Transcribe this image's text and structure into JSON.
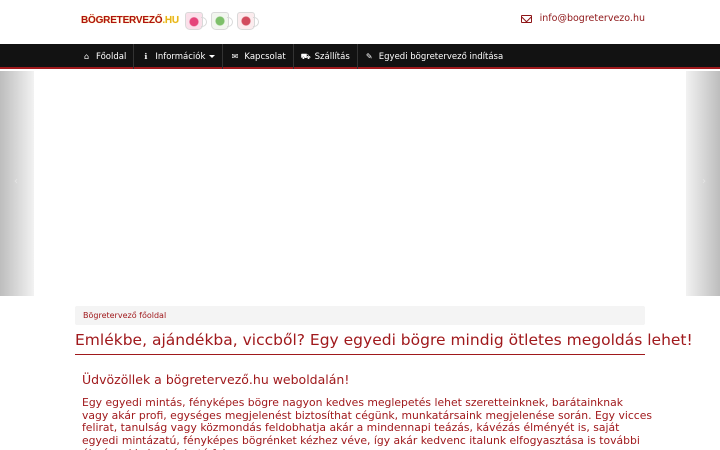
{
  "header": {
    "logo_main": "BÖGRETERVEZŐ",
    "logo_suffix": ".HU",
    "logo_icon_names": [
      "heart-mug-icon",
      "photo-mug-icon",
      "floral-mug-icon"
    ],
    "email": "info@bogretervezo.hu",
    "email_icon": "envelope-icon"
  },
  "nav": {
    "items": [
      {
        "label": "Főoldal",
        "icon": "home-icon"
      },
      {
        "label": "Információk",
        "icon": "info-icon"
      },
      {
        "label": "Kapcsolat",
        "icon": "envelope-icon"
      },
      {
        "label": "Szállítás",
        "icon": "truck-icon"
      },
      {
        "label": "Egyedi bögretervező indítása",
        "icon": "edit-icon"
      }
    ]
  },
  "carousel": {
    "prev_icon": "chevron-left-icon",
    "next_icon": "chevron-right-icon"
  },
  "breadcrumb": {
    "current": "Bögretervező főoldal"
  },
  "main": {
    "title": "Emlékbe, ajándékba, viccből? Egy egyedi bögre mindig ötletes megoldás lehet!",
    "welcome": "Üdvözöllek a bögretervező.hu weboldalán!",
    "intro": "Egy egyedi mintás, fényképes bögre nagyon kedves meglepetés lehet szeretteinknek, barátainknak vagy akár profi, egységes megjelenést biztosíthat cégünk, munkatársaink megjelenése során. Egy vicces felirat, tanulság vagy közmondás feldobhatja akár a mindennapi teázás, kávézás élményét is, saját egyedi mintázatú, fényképes bögrénket kézhez véve, így akár kedvenc italunk elfogyasztása is további élményekkel ruházható fel."
  },
  "colors": {
    "accent": "#a0191c",
    "navbar": "#121212",
    "breadcrumb_bg": "#f4f4f4"
  }
}
